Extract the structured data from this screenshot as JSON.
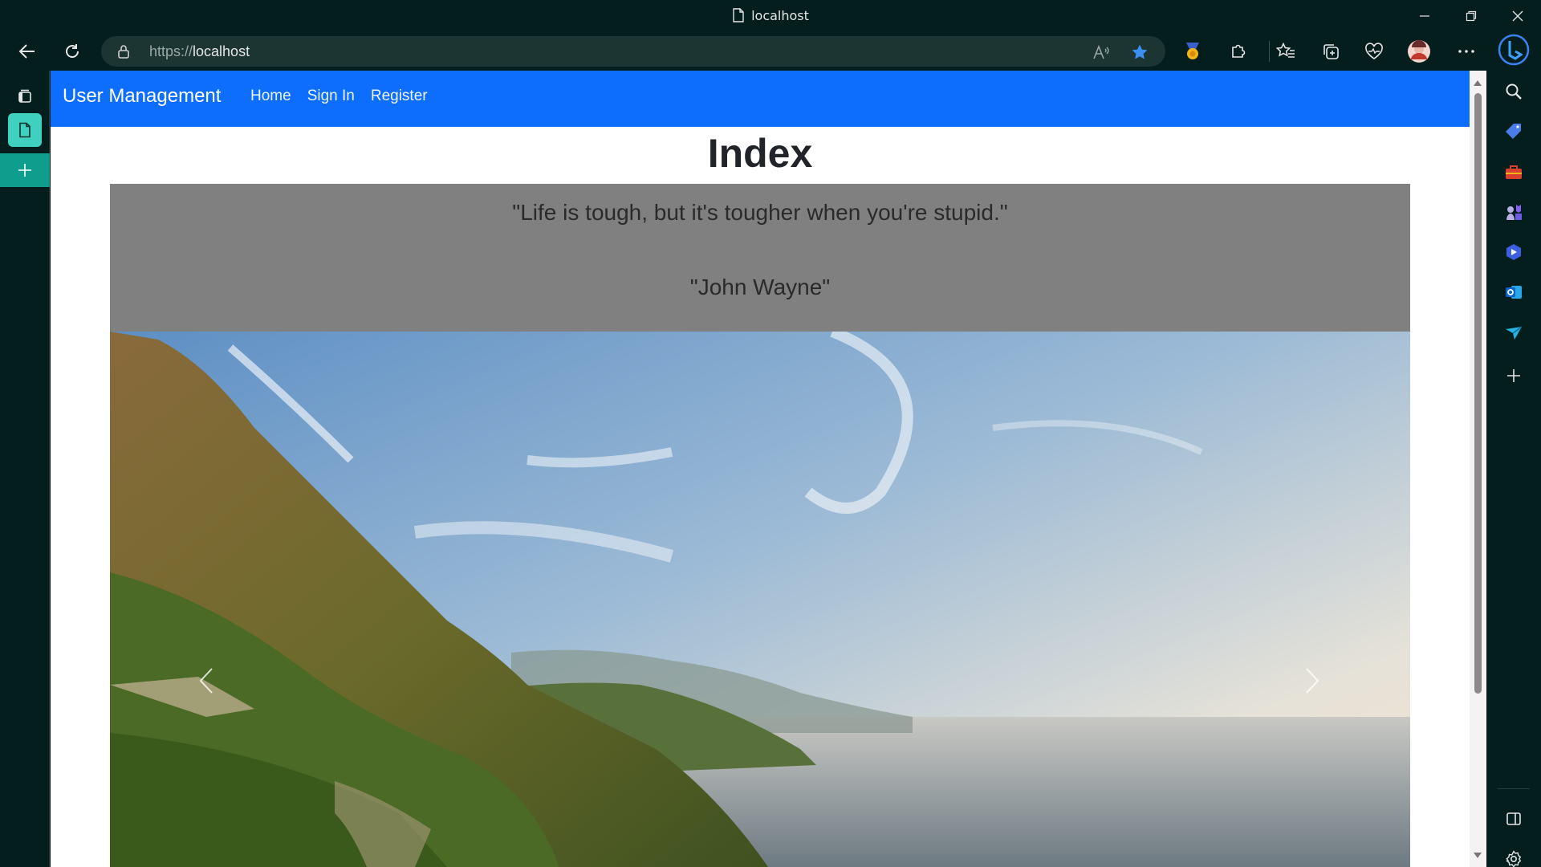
{
  "browser": {
    "tab_title": "localhost",
    "url_scheme": "https://",
    "url_host": "localhost",
    "accent": "#0d6efd"
  },
  "navbar": {
    "brand": "User Management",
    "links": [
      "Home",
      "Sign In",
      "Register"
    ]
  },
  "page": {
    "title": "Index"
  },
  "quote": {
    "text": "\"Life is tough, but it's tougher when you're stupid.\"",
    "author": "\"John Wayne\""
  },
  "icons": {
    "left_sidebar": [
      "tab-actions-icon",
      "page-tab-icon",
      "new-tab-icon"
    ],
    "right_sidebar": [
      "search-icon",
      "shopping-tag-icon",
      "tools-icon",
      "games-icon",
      "copilot-icon",
      "outlook-icon",
      "send-icon",
      "add-icon",
      "sidebar-toggle-icon",
      "settings-icon"
    ]
  }
}
